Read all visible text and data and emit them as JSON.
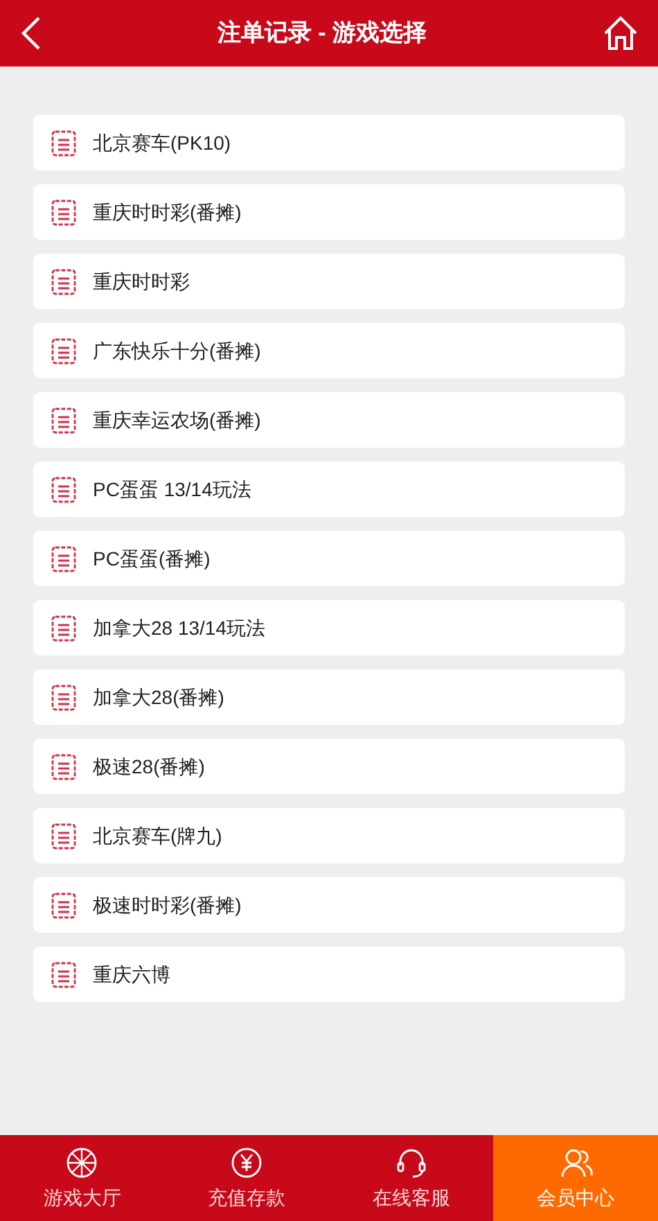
{
  "header": {
    "title": "注单记录 - 游戏选择"
  },
  "games": [
    {
      "label": "北京赛车(PK10)"
    },
    {
      "label": "重庆时时彩(番摊)"
    },
    {
      "label": "重庆时时彩"
    },
    {
      "label": "广东快乐十分(番摊)"
    },
    {
      "label": "重庆幸运农场(番摊)"
    },
    {
      "label": "PC蛋蛋 13/14玩法"
    },
    {
      "label": "PC蛋蛋(番摊)"
    },
    {
      "label": "加拿大28 13/14玩法"
    },
    {
      "label": "加拿大28(番摊)"
    },
    {
      "label": "极速28(番摊)"
    },
    {
      "label": "北京赛车(牌九)"
    },
    {
      "label": "极速时时彩(番摊)"
    },
    {
      "label": "重庆六博"
    }
  ],
  "tab_bar": [
    {
      "label": "游戏大厅",
      "kind": "wheel",
      "selected": false
    },
    {
      "label": "充值存款",
      "kind": "yen",
      "selected": false
    },
    {
      "label": "在线客服",
      "kind": "headset",
      "selected": false
    },
    {
      "label": "会员中心",
      "kind": "users",
      "selected": true
    }
  ]
}
